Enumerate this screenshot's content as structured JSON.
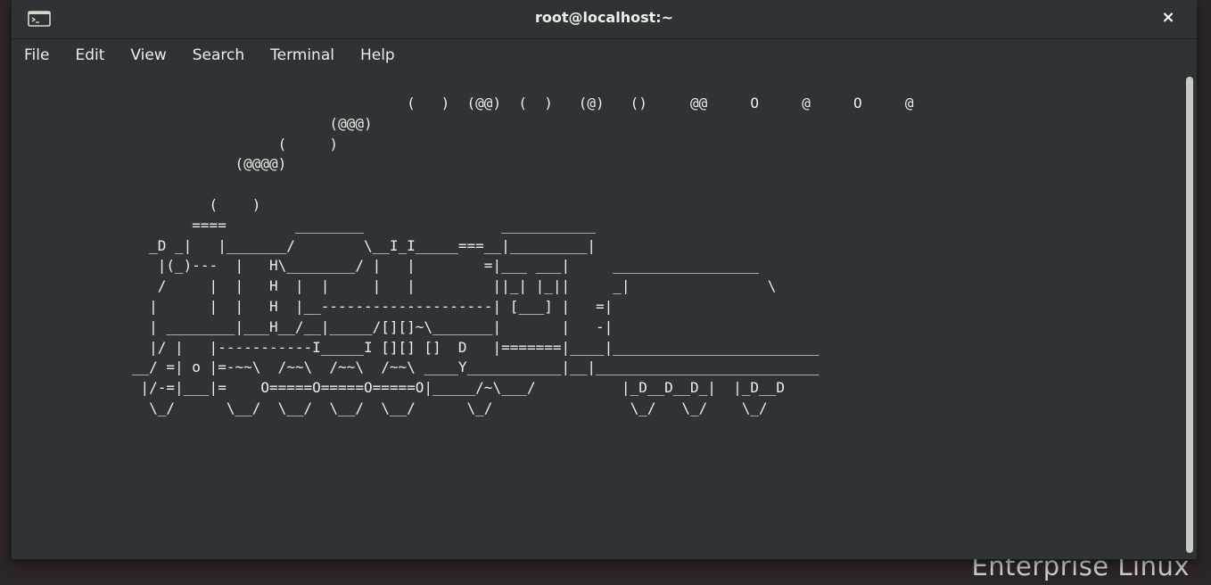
{
  "window": {
    "title": "root@localhost:~",
    "close_icon": "×"
  },
  "menu": [
    "File",
    "Edit",
    "View",
    "Search",
    "Terminal",
    "Help"
  ],
  "terminal": {
    "output": "                                              (   )  (@@)  (  )   (@)   ()     @@     O     @     O     @\n                                     (@@@)\n                               (     )\n                          (@@@@)\n\n                       (    )\n                     ====        ________                ___________\n                _D _|   |_______/        \\__I_I_____===__|_________|\n                 |(_)---  |   H\\________/ |   |        =|___ ___|     _________________\n                 /     |  |   H  |  |     |   |         ||_| |_||     _|                \\\n                |      |  |   H  |__--------------------| [___] |   =|\n                | ________|___H__/__|_____/[][]~\\_______|       |   -|\n                |/ |   |-----------I_____I [][] []  D   |=======|____|________________________\n              __/ =| o |=-~~\\  /~~\\  /~~\\  /~~\\ ____Y___________|__|__________________________\n               |/-=|___|=    O=====O=====O=====O|_____/~\\___/          |_D__D__D_|  |_D__D\n                \\_/      \\__/  \\__/  \\__/  \\__/      \\_/                \\_/   \\_/    \\_/"
  },
  "desktop": {
    "brand_text": "Enterprise Linux"
  },
  "colors": {
    "terminal_bg": "#2e3436",
    "terminal_fg": "#eeeeec",
    "titlebar_bg": "#2f3335",
    "scrollbar_thumb": "#c8c9c7"
  }
}
